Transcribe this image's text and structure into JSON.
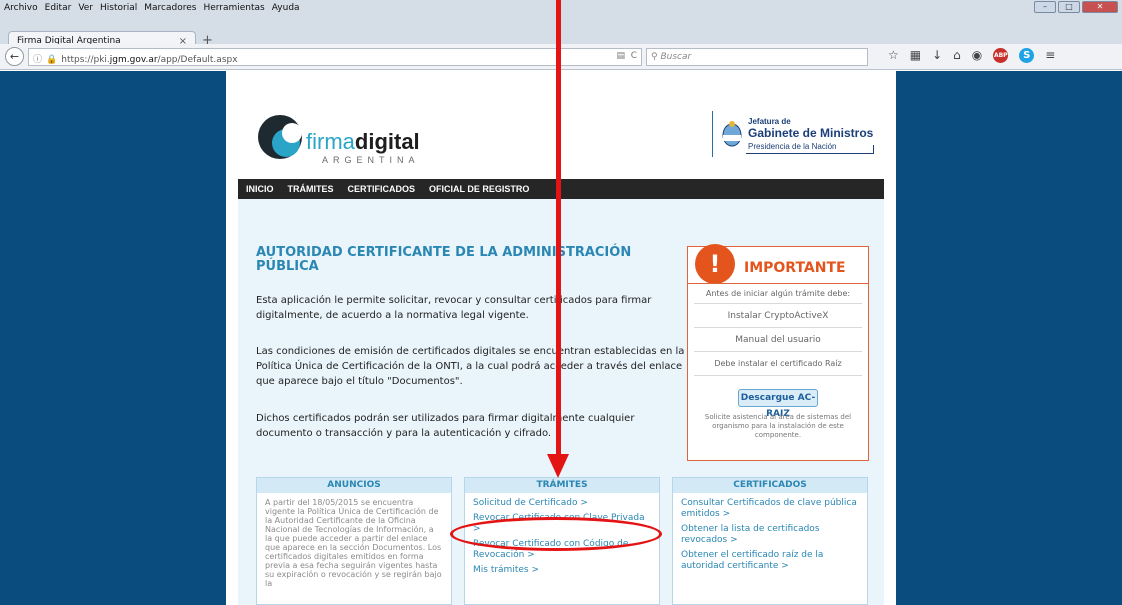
{
  "menubar": {
    "items": [
      "Archivo",
      "Editar",
      "Ver",
      "Historial",
      "Marcadores",
      "Herramientas",
      "Ayuda"
    ]
  },
  "tab": {
    "title": "Firma Digital Argentina",
    "close": "×",
    "new": "+"
  },
  "nav": {
    "url_prefix": "https://pki.",
    "url_host": "jgm.gov.ar",
    "url_path": "/app/Default.aspx",
    "search_placeholder": "Buscar"
  },
  "logo": {
    "word_light": "firma",
    "word_bold": "digital",
    "sub": "ARGENTINA"
  },
  "gob": {
    "line1": "Jefatura de",
    "line2": "Gabinete de Ministros",
    "line3": "Presidencia de la Nación"
  },
  "topnav": [
    "INICIO",
    "TRÁMITES",
    "CERTIFICADOS",
    "OFICIAL DE REGISTRO"
  ],
  "main": {
    "title": "AUTORIDAD CERTIFICANTE DE LA ADMINISTRACIÓN PÚBLICA",
    "p1": "Esta aplicación le permite solicitar, revocar y consultar certificados para firmar digitalmente, de acuerdo a la normativa legal vigente.",
    "p2": "Las condiciones de emisión de certificados digitales se encuentran establecidas en la Política Única de Certificación de la ONTI, a la cual podrá acceder a través del enlace que aparece bajo el título \"Documentos\".",
    "p3": "Dichos certificados podrán ser utilizados para firmar digitalmente cualquier documento o transacción y para la autenticación y cifrado."
  },
  "important": {
    "icon": "!",
    "title": "IMPORTANTE",
    "intro": "Antes de iniciar algún trámite debe:",
    "item1": "Instalar CryptoActiveX",
    "item2": "Manual del usuario",
    "item3": "Debe instalar el certificado Raíz",
    "button": "Descargue AC-RAIZ",
    "note": "Solicite asistencia al área de sistemas del organismo para la instalación de este componente."
  },
  "anuncios": {
    "title": "ANUNCIOS",
    "text": "A partir del 18/05/2015 se encuentra vigente la Política Única de Certificación de la Autoridad Certificante de la Oficina Nacional de Tecnologías de Información, a la que puede acceder a partir del enlace que aparece en la sección Documentos. Los certificados digitales emitidos en forma previa a esa fecha seguirán vigentes hasta su expiración o revocación y se regirán bajo la"
  },
  "tramites": {
    "title": "TRÁMITES",
    "links": [
      "Solicitud de Certificado >",
      "Revocar Certificado con Clave Privada >",
      "Revocar Certificado con Código de Revocación >",
      "Mis trámites >"
    ]
  },
  "certificados": {
    "title": "CERTIFICADOS",
    "links": [
      "Consultar Certificados de clave pública emitidos >",
      "Obtener la lista de certificados revocados >",
      "Obtener el certificado raíz de la autoridad certificante >"
    ]
  },
  "colors": {
    "page_bg": "#0b4c7e",
    "accent": "#2a87b3",
    "important": "#e4551d",
    "annotation": "#e51414"
  }
}
